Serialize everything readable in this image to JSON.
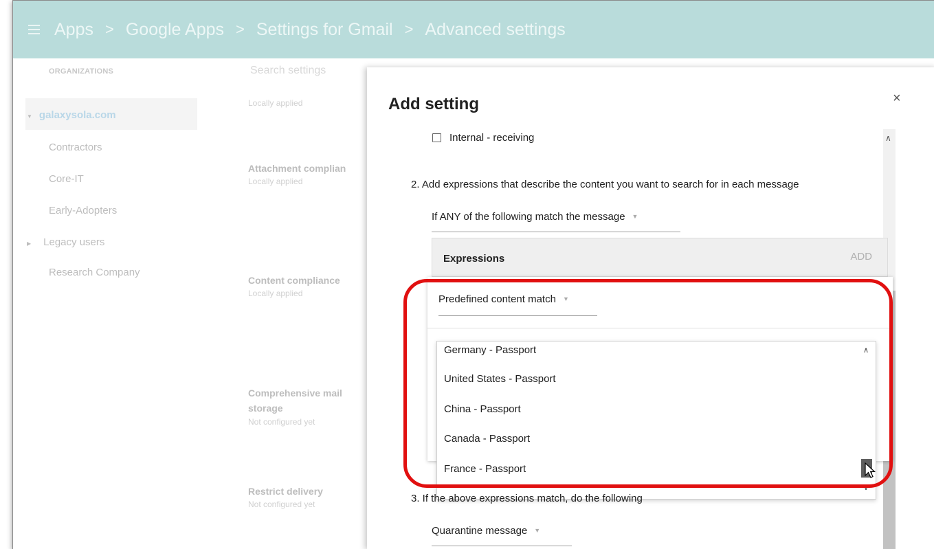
{
  "header": {
    "crumbs": [
      "Apps",
      "Google Apps",
      "Settings for Gmail",
      "Advanced settings"
    ],
    "separator": ">"
  },
  "sidebar": {
    "heading": "ORGANIZATIONS",
    "search_placeholder": "Search settings",
    "root": "galaxysola.com",
    "items": [
      "Contractors",
      "Core-IT",
      "Early-Adopters",
      "Legacy users",
      "Research Company"
    ]
  },
  "settings": [
    {
      "title": "Locally applied",
      "sub": ""
    },
    {
      "title": "Attachment complian",
      "sub": "Locally applied"
    },
    {
      "title": "Content compliance",
      "sub": "Locally applied"
    },
    {
      "title_line1": "Comprehensive mail",
      "title_line2": "storage",
      "sub": "Not configured yet"
    },
    {
      "title": "Restrict delivery",
      "sub": "Not configured yet"
    }
  ],
  "dialog": {
    "title": "Add setting",
    "close": "×",
    "checkbox_label": "Internal - receiving",
    "step2": "2. Add expressions that describe the content you want to search for in each message",
    "match_mode": "If ANY of the following match the message",
    "expressions_label": "Expressions",
    "add_label": "ADD",
    "expression_type": "Predefined content match",
    "dropdown_options": [
      "Germany - Passport",
      "United States - Passport",
      "China - Passport",
      "Canada - Passport",
      "France - Passport"
    ],
    "step3": "3. If the above expressions match, do the following",
    "action": "Quarantine message"
  },
  "colors": {
    "topbar": "#b9dcdb",
    "highlight": "#e11010"
  }
}
